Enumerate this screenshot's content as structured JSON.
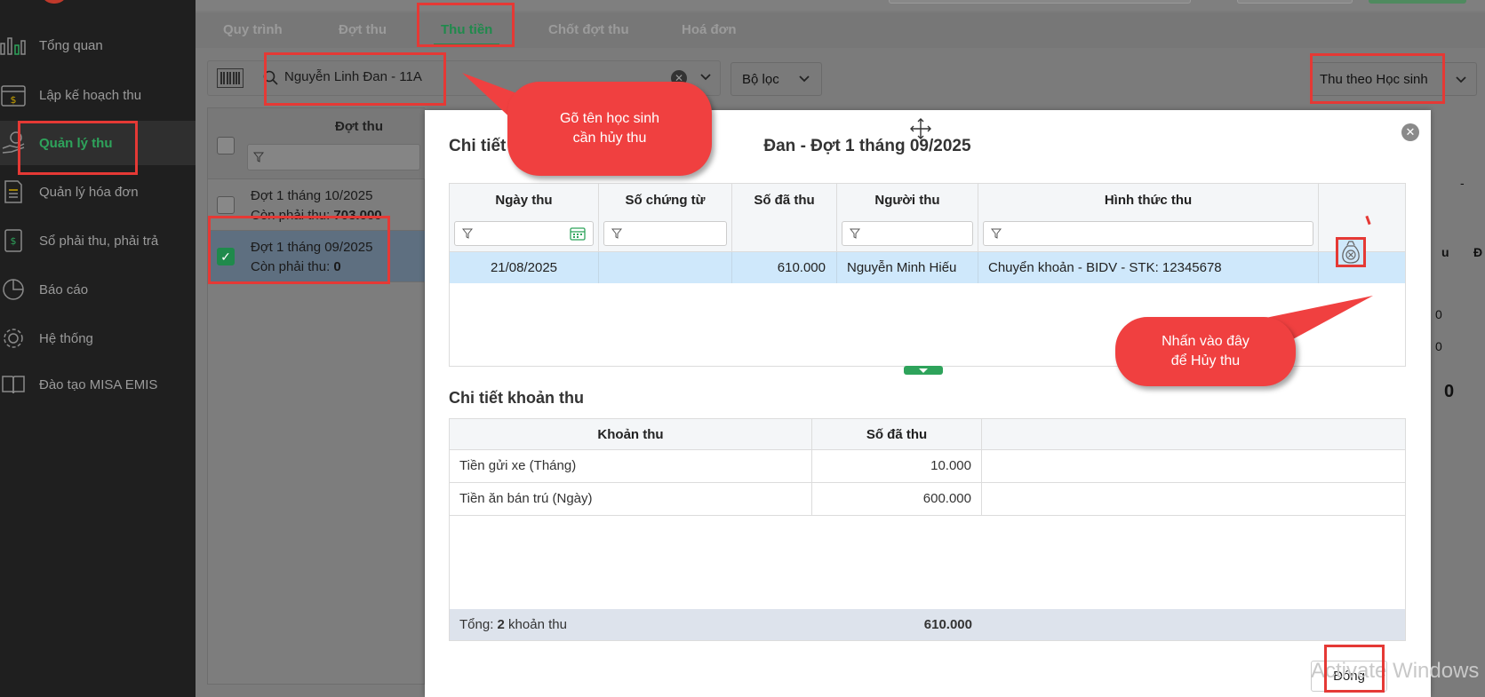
{
  "sidebar": {
    "items": [
      {
        "label": "Tổng quan",
        "icon": "chart-icon"
      },
      {
        "label": "Lập kế hoạch thu",
        "icon": "calendar-money-icon"
      },
      {
        "label": "Quản lý thu",
        "icon": "hand-money-icon"
      },
      {
        "label": "Quản lý hóa đơn",
        "icon": "invoice-icon"
      },
      {
        "label": "Sổ phải thu, phải trả",
        "icon": "ledger-icon"
      },
      {
        "label": "Báo cáo",
        "icon": "pie-chart-icon"
      },
      {
        "label": "Hệ thống",
        "icon": "gear-icon"
      },
      {
        "label": "Đào tạo MISA EMIS",
        "icon": "book-icon"
      }
    ]
  },
  "tabs": [
    "Quy trình",
    "Đợt thu",
    "Thu tiền",
    "Chốt đợt thu",
    "Hoá đơn"
  ],
  "toolbar": {
    "search_value": "Nguyễn Linh Đan - 11A",
    "filter_label": "Bộ lọc",
    "mode_label": "Thu theo Học sinh"
  },
  "left_table": {
    "header": "Đợt thu",
    "rows": [
      {
        "title": "Đợt 1 tháng 10/2025",
        "remain_label": "Còn phải thu:",
        "remain_value": "703.000"
      },
      {
        "title": "Đợt 1 tháng 09/2025",
        "remain_label": "Còn phải thu:",
        "remain_value": "0"
      }
    ]
  },
  "right_bits": {
    "dash": "-",
    "u": "u",
    "d": "Đ",
    "zero1": "0",
    "zero2": "0",
    "zero_big": "0"
  },
  "modal": {
    "title_start": "Chi tiết",
    "title_end": "Đan - Đợt 1 tháng 09/2025",
    "payments": {
      "columns": [
        "Ngày thu",
        "Số chứng từ",
        "Số đã thu",
        "Người thu",
        "Hình thức thu"
      ],
      "rows": [
        {
          "date": "21/08/2025",
          "voucher": "",
          "amount": "610.000",
          "collector": "Nguyễn Minh Hiếu",
          "method": "Chuyển khoản - BIDV - STK: 12345678"
        }
      ]
    },
    "items_title": "Chi tiết khoản thu",
    "items": {
      "columns": [
        "Khoản thu",
        "Số đã thu"
      ],
      "rows": [
        {
          "name": "Tiền gửi xe (Tháng)",
          "amount": "10.000"
        },
        {
          "name": "Tiền ăn bán trú (Ngày)",
          "amount": "600.000"
        }
      ],
      "total_label": "Tổng:",
      "total_count": "2",
      "total_suffix": "khoản thu",
      "total_amount": "610.000"
    },
    "close_label": "Đóng"
  },
  "callouts": {
    "search_hint": "Gõ tên học sinh cần hủy thu",
    "cancel_hint": "Nhấn vào đây để Hủy thu"
  },
  "watermark": "Activate Windows",
  "colors": {
    "accent": "#2ea35b",
    "annotation": "#e53935",
    "callout": "#f04040",
    "selected_row": "#cfe8fb"
  }
}
